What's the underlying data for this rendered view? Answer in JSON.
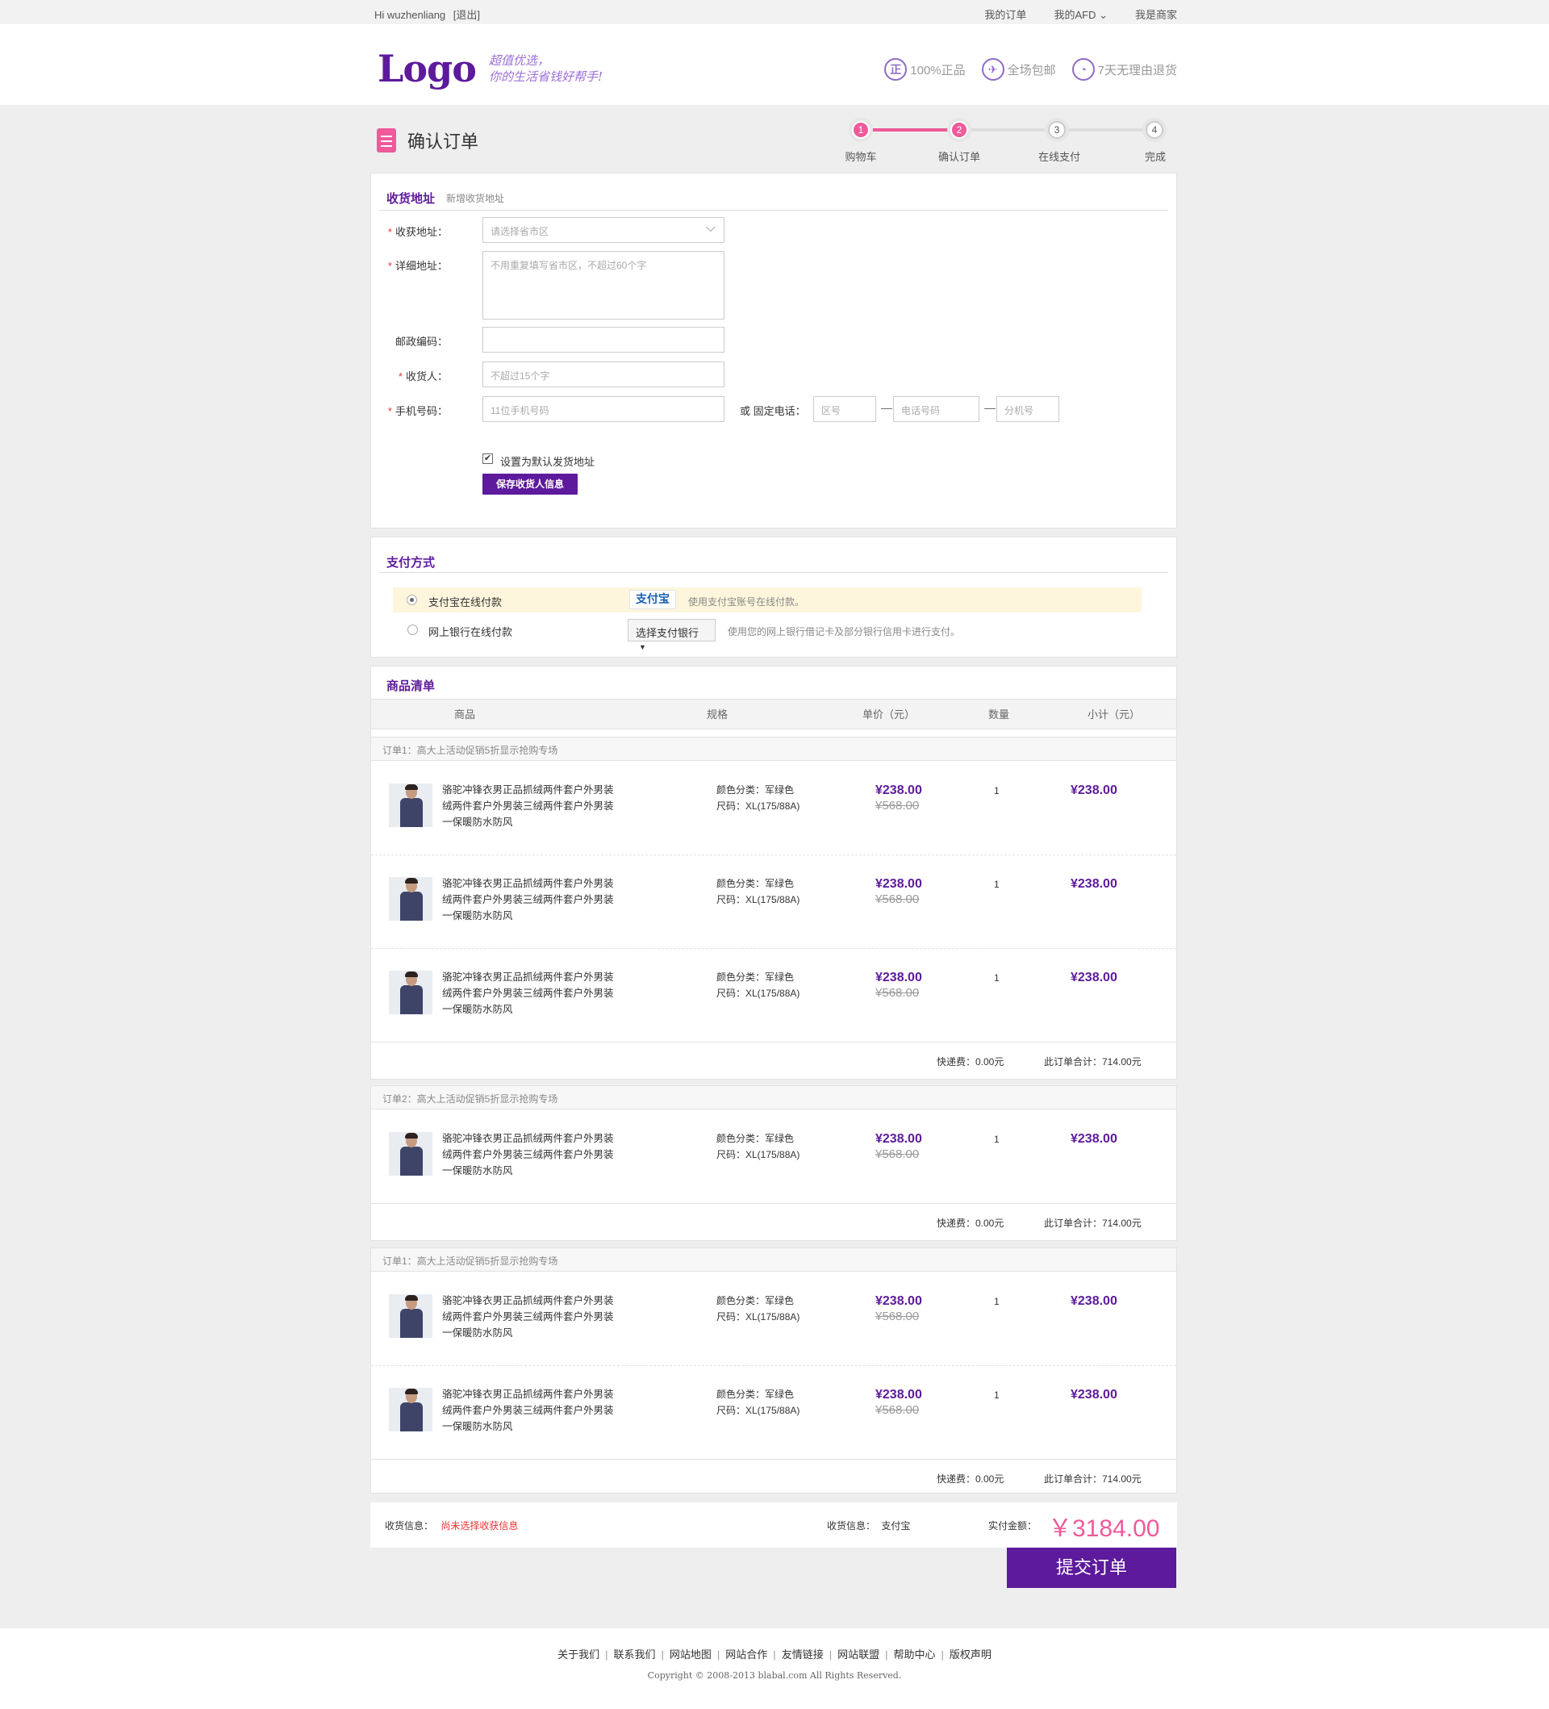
{
  "topbar": {
    "greeting": "Hi wuzhenliang",
    "logout": "[退出]",
    "links": [
      "我的订单",
      "我的AFD",
      "我是商家"
    ]
  },
  "header": {
    "logo": "Logo",
    "slogan_line1": "超值优选，",
    "slogan_line2": "你的生活省钱好帮手!",
    "promises": [
      {
        "icon": "正",
        "text": "100%正品"
      },
      {
        "icon": "✈",
        "text": "全场包邮"
      },
      {
        "icon": "◔",
        "text": "7天无理由退货"
      }
    ]
  },
  "page_title": "确认订单",
  "steps": [
    {
      "num": "1",
      "label": "购物车"
    },
    {
      "num": "2",
      "label": "确认订单"
    },
    {
      "num": "3",
      "label": "在线支付"
    },
    {
      "num": "4",
      "label": "完成"
    }
  ],
  "address": {
    "title": "收货地址",
    "new_link": "新增收货地址",
    "region_label": "收获地址：",
    "region_placeholder": "请选择省市区",
    "detail_label": "详细地址：",
    "detail_placeholder": "不用重复填写省市区，不超过60个字",
    "zip_label": "邮政编码：",
    "name_label": "收货人：",
    "name_placeholder": "不超过15个字",
    "mobile_label": "手机号码：",
    "mobile_placeholder": "11位手机号码",
    "phone_label": "或 固定电话：",
    "area_placeholder": "区号",
    "tel_placeholder": "电话号码",
    "ext_placeholder": "分机号",
    "default_label": "设置为默认发货地址",
    "save_button": "保存收货人信息"
  },
  "payment": {
    "title": "支付方式",
    "options": [
      {
        "label": "支付宝在线付款",
        "logo": "支付宝",
        "desc": "使用支付宝账号在线付款。",
        "selected": true
      },
      {
        "label": "网上银行在线付款",
        "select": "选择支付银行",
        "desc": "使用您的网上银行借记卡及部分银行信用卡进行支付。",
        "selected": false
      }
    ]
  },
  "goods": {
    "title": "商品清单",
    "columns": [
      "商品",
      "规格",
      "单价（元）",
      "数量",
      "小计（元）"
    ],
    "product": {
      "name": [
        "骆驼冲锋衣男正品抓绒两件套户外男装",
        "绒两件套户外男装三绒两件套户外男装",
        "一保暖防水防风"
      ],
      "spec_color": "颜色分类：军绿色",
      "spec_size": "尺码：XL(175/88A)",
      "price": "¥238.00",
      "old_price": "¥568.00",
      "qty": "1",
      "subtotal": "¥238.00"
    },
    "groups": [
      {
        "title": "订单1：高大上活动促销5折显示抢购专场",
        "fee": "快递费：0.00元",
        "total": "此订单合计：714.00元"
      },
      {
        "title": "订单2：高大上活动促销5折显示抢购专场",
        "fee": "快递费：0.00元",
        "total": "此订单合计：714.00元"
      },
      {
        "title": "订单1：高大上活动促销5折显示抢购专场",
        "fee": "快递费：0.00元",
        "total": "此订单合计：714.00元"
      }
    ]
  },
  "summary": {
    "ship_label": "收货信息：",
    "ship_value": "尚未选择收获信息",
    "pay_label": "收货信息：",
    "pay_value": "支付宝",
    "amount_label": "实付金额：",
    "amount": "￥3184.00",
    "submit": "提交订单"
  },
  "footer": {
    "links": [
      "关于我们",
      "联系我们",
      "网站地图",
      "网站合作",
      "友情链接",
      "网站联盟",
      "帮助中心",
      "版权声明"
    ],
    "copyright": "Copyright © 2008-2013 blabal.com All Rights Reserved."
  },
  "colors": {
    "brand": "#5d1a9c",
    "accent": "#ee5a9a",
    "warning": "#e33333",
    "pay_highlight": "#fdf6dc"
  }
}
